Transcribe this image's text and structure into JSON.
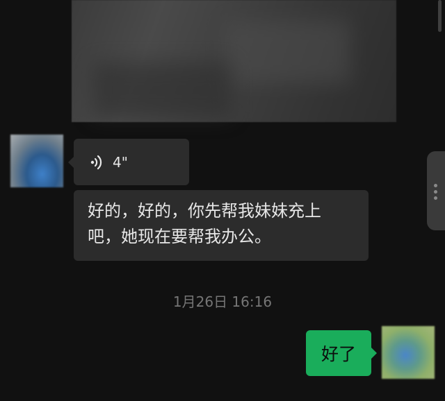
{
  "chat": {
    "voice_message": {
      "duration": "4\"",
      "icon": "voice-wave-icon"
    },
    "text_message": {
      "line1": "好的，好的，你先帮我妹妹充上",
      "line2": "吧，她现在要帮我办公。"
    },
    "timestamp": "1月26日 16:16",
    "reply_message": "好了"
  },
  "colors": {
    "background": "#111111",
    "incoming_bubble": "#2c2c2c",
    "outgoing_bubble": "#1aad5b",
    "timestamp_text": "#767676"
  }
}
